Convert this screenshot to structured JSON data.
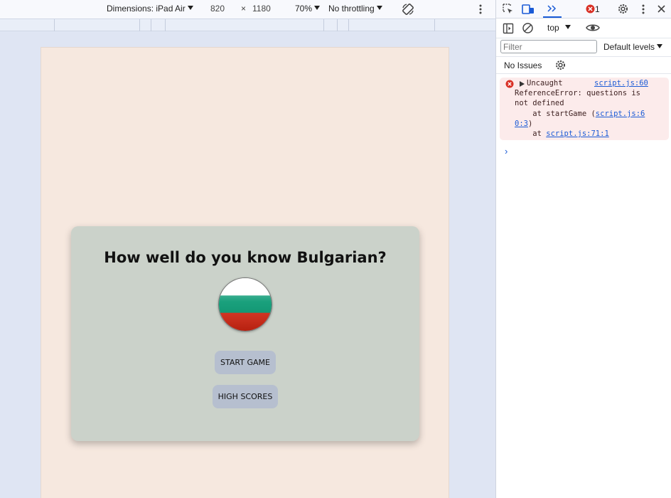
{
  "device_toolbar": {
    "dimensions_label": "Dimensions: iPad Air",
    "width": "820",
    "times": "×",
    "height": "1180",
    "zoom": "70%",
    "throttling": "No throttling"
  },
  "page": {
    "title": "How well do you know Bulgarian?",
    "flag_colors": [
      "#ffffff",
      "#00966e",
      "#d62612"
    ],
    "start_button": "START GAME",
    "scores_button": "HIGH SCORES"
  },
  "devtools": {
    "error_count": "1",
    "context": "top",
    "filter_placeholder": "Filter",
    "levels": "Default levels",
    "issues": "No Issues",
    "error": {
      "prefix": "Uncaught",
      "link_main": "script.js:60",
      "line2": "ReferenceError: questions is",
      "line3": "not defined",
      "line4_text": "    at startGame (",
      "line4_link": "script.js:6",
      "line5_link": "0:3",
      "line5_text": ")",
      "line6_text": "    at ",
      "line6_link": "script.js:71:1"
    },
    "prompt": "›"
  }
}
